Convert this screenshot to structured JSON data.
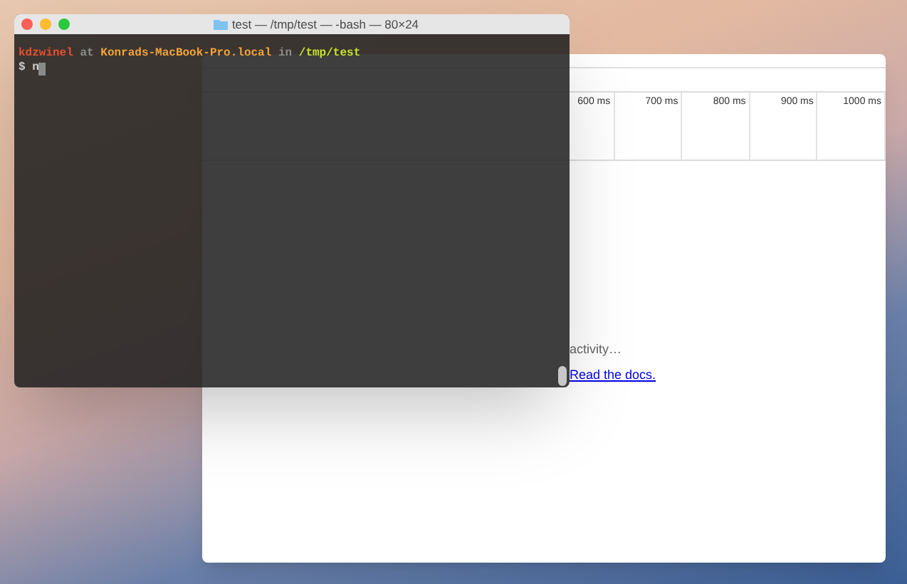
{
  "terminal": {
    "title": "test — /tmp/test — -bash — 80×24",
    "prompt_segments": [
      {
        "text": "kdzwinel",
        "kind": "user"
      },
      {
        "text": "at",
        "kind": "plain"
      },
      {
        "text": "Konrads-MacBook-Pro.local",
        "kind": "host"
      },
      {
        "text": "in",
        "kind": "plain"
      },
      {
        "text": "/tmp/test",
        "kind": "path"
      }
    ],
    "command_line": {
      "prompt": "$",
      "input": "n"
    }
  },
  "devtools": {
    "timeline_ticks": [
      "600 ms",
      "700 ms",
      "800 ms",
      "900 ms",
      "1000 ms"
    ],
    "empty_state": {
      "message": "activity…",
      "link": "Read the docs."
    }
  }
}
